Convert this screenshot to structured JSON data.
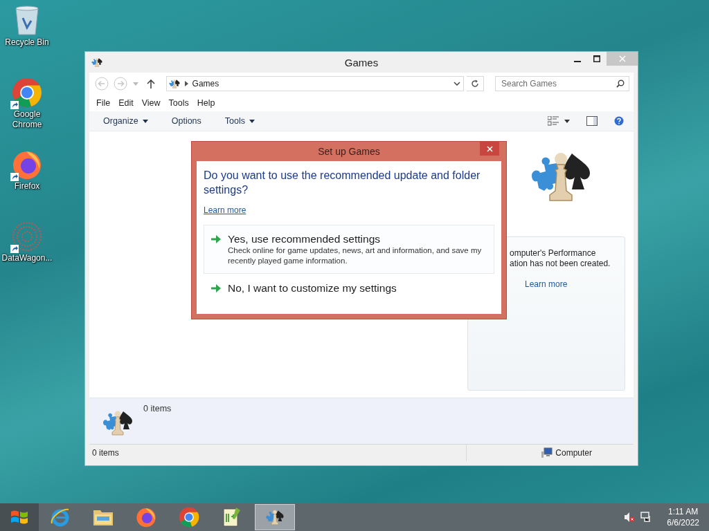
{
  "desktop_icons": [
    {
      "label": "Recycle Bin",
      "kind": "bin",
      "shortcut": false
    },
    {
      "label": "Google Chrome",
      "kind": "chrome",
      "shortcut": true
    },
    {
      "label": "Firefox",
      "kind": "firefox",
      "shortcut": true
    },
    {
      "label": "DataWagon...",
      "kind": "datawagon",
      "shortcut": true
    }
  ],
  "window": {
    "title": "Games",
    "address": {
      "path": "Games"
    },
    "search": {
      "placeholder": "Search Games"
    },
    "menu": [
      "File",
      "Edit",
      "View",
      "Tools",
      "Help"
    ],
    "toolbar": [
      {
        "label": "Organize",
        "dropdown": true
      },
      {
        "label": "Options",
        "dropdown": false
      },
      {
        "label": "Tools",
        "dropdown": true
      }
    ],
    "preview_pane": {
      "lines": [
        "omputer's Performance",
        "ation has not been created."
      ],
      "link": "Learn more"
    },
    "details_pane": {
      "count": "0 items"
    },
    "status_bar": {
      "items": "0 items",
      "zone": "Computer"
    }
  },
  "dialog": {
    "title": "Set up Games",
    "question": "Do you want to use the recommended update and folder settings?",
    "link": "Learn more",
    "options": [
      {
        "title": "Yes, use recommended settings",
        "description": "Check online for game updates, news, art and information, and save my recently played game information.",
        "selected": true
      },
      {
        "title": "No, I want to customize my settings",
        "selected": false
      }
    ]
  },
  "taskbar": {
    "apps": [
      {
        "kind": "ie",
        "active": false
      },
      {
        "kind": "explorer",
        "active": false
      },
      {
        "kind": "firefox",
        "active": false
      },
      {
        "kind": "chrome",
        "active": false
      },
      {
        "kind": "notepad",
        "active": false
      },
      {
        "kind": "games",
        "active": true
      }
    ],
    "clock": {
      "time": "1:11 AM",
      "date": "6/6/2022"
    }
  }
}
